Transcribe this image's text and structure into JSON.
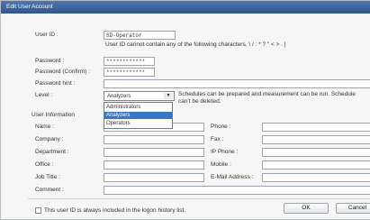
{
  "window": {
    "title": "Edit User Account"
  },
  "user_id": {
    "label": "User ID :",
    "value": "SD-Operator",
    "hint": "User ID cannot contain any of the following characters. \\ / : * ? \" < > . |"
  },
  "password": {
    "label": "Password :",
    "value": "************"
  },
  "password_confirm": {
    "label": "Password (Confirm) :",
    "value": "************"
  },
  "password_hint": {
    "label": "Password hint :",
    "value": ""
  },
  "level": {
    "label": "Level :",
    "selected": "Analyzers",
    "options": [
      "Administrators",
      "Analyzers",
      "Operators"
    ],
    "description_line1": "Schedules can be prepared and measurement can be run. Schedule",
    "description_line2": "can't be deleted."
  },
  "user_information": {
    "heading": "User Information",
    "name": {
      "label": "Name :",
      "value": ""
    },
    "company": {
      "label": "Company :",
      "value": ""
    },
    "department": {
      "label": "Department :",
      "value": ""
    },
    "office": {
      "label": "Office :",
      "value": ""
    },
    "job_title": {
      "label": "Job Title :",
      "value": ""
    },
    "comment": {
      "label": "Comment :",
      "value": ""
    },
    "phone": {
      "label": "Phone :",
      "value": ""
    },
    "fax": {
      "label": "Fax :",
      "value": ""
    },
    "ip_phone": {
      "label": "IP Phone :",
      "value": ""
    },
    "mobile": {
      "label": "Mobile :",
      "value": ""
    },
    "email": {
      "label": "E-Mail Address :",
      "value": ""
    }
  },
  "history_checkbox": {
    "label": "This user ID is always included in the logon history list.",
    "checked": false
  },
  "buttons": {
    "ok": "OK",
    "cancel": "Cancel"
  }
}
